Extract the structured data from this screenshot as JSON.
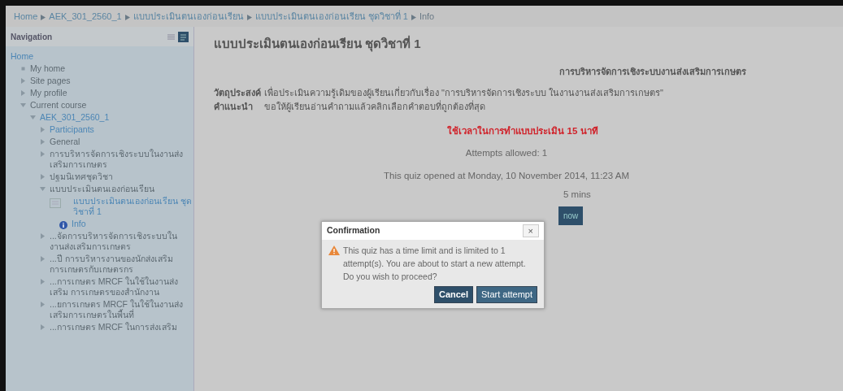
{
  "breadcrumb": [
    "Home",
    "AEK_301_2560_1",
    "แบบประเมินตนเองก่อนเรียน",
    "แบบประเมินตนเองก่อนเรียน ชุดวิชาที่ 1",
    "Info"
  ],
  "navigation": {
    "title": "Navigation",
    "items": [
      {
        "label": "Home",
        "kind": "link",
        "children": [
          {
            "label": "My home",
            "kind": "bullet"
          },
          {
            "label": "Site pages",
            "kind": "branch",
            "expanded": false
          },
          {
            "label": "My profile",
            "kind": "branch",
            "expanded": false
          },
          {
            "label": "Current course",
            "kind": "branch",
            "expanded": true,
            "children": [
              {
                "label": "AEK_301_2560_1",
                "kind": "branch",
                "expanded": true,
                "link": true,
                "children": [
                  {
                    "label": "Participants",
                    "kind": "branch",
                    "expanded": false,
                    "link": true
                  },
                  {
                    "label": "General",
                    "kind": "branch",
                    "expanded": false
                  },
                  {
                    "label": "การบริหารจัดการเชิงระบบในงานส่งเสริมการเกษตร",
                    "kind": "branch",
                    "expanded": false
                  },
                  {
                    "label": "ปฐมนิเทศชุดวิชา",
                    "kind": "branch",
                    "expanded": false
                  },
                  {
                    "label": "แบบประเมินตนเองก่อนเรียน",
                    "kind": "branch",
                    "expanded": true,
                    "children": [
                      {
                        "label": "แบบประเมินตนเองก่อนเรียน ชุดวิชาที่ 1",
                        "kind": "quiz",
                        "link": true,
                        "children": [
                          {
                            "label": "Info",
                            "kind": "info",
                            "link": true
                          }
                        ]
                      }
                    ]
                  },
                  {
                    "label": "...จัดการบริหารจัดการเชิงระบบใน งานส่งเสริมการเกษตร",
                    "kind": "branch",
                    "expanded": false
                  },
                  {
                    "label": "...ปี การบริหารงานของนักส่งเสริม การเกษตรกับเกษตรกร",
                    "kind": "branch",
                    "expanded": false
                  },
                  {
                    "label": "...การเกษตร MRCF ในใช้ในงานส่งเสริม การเกษตรของสำนักงาน",
                    "kind": "branch",
                    "expanded": false
                  },
                  {
                    "label": "...ยการเกษตร MRCF ในใช้ในงานส่ง เสริมการเกษตรในพื้นที่",
                    "kind": "branch",
                    "expanded": false
                  },
                  {
                    "label": "...การเกษตร MRCF ในการส่งเสริม",
                    "kind": "branch",
                    "expanded": false
                  }
                ]
              }
            ]
          }
        ]
      }
    ]
  },
  "main": {
    "title": "แบบประเมินตนเองก่อนเรียน ชุดวิชาที่ 1",
    "subject": "การบริหารจัดการเชิงระบบงานส่งเสริมการเกษตร",
    "fields": [
      {
        "label": "วัตถุประสงค์",
        "value": "เพื่อประเมินความรู้เดิมของผู้เรียนเกี่ยวกับเรื่อง \"การบริหารจัดการเชิงระบบ ในงานงานส่งเสริมการเกษตร\""
      },
      {
        "label": "คำแนะนำ",
        "value": "ขอให้ผู้เรียนอ่านคำถามแล้วคลิกเลือกคำตอบที่ถูกต้องที่สุด"
      }
    ],
    "time_note": "ใช้เวลาในการทำแบบประเมิน 15 นาที",
    "attempts": "Attempts allowed: 1",
    "opened": "This quiz opened at Monday, 10 November 2014, 11:23 AM",
    "time_limit_visible": "5 mins",
    "attempt_button_visible": "now"
  },
  "dialog": {
    "title": "Confirmation",
    "close": "×",
    "message": "This quiz has a time limit and is limited to 1 attempt(s). You are about to start a new attempt. Do you wish to proceed?",
    "buttons": [
      {
        "label": "Cancel",
        "kind": "primary"
      },
      {
        "label": "Start attempt",
        "kind": "secondary"
      }
    ]
  }
}
